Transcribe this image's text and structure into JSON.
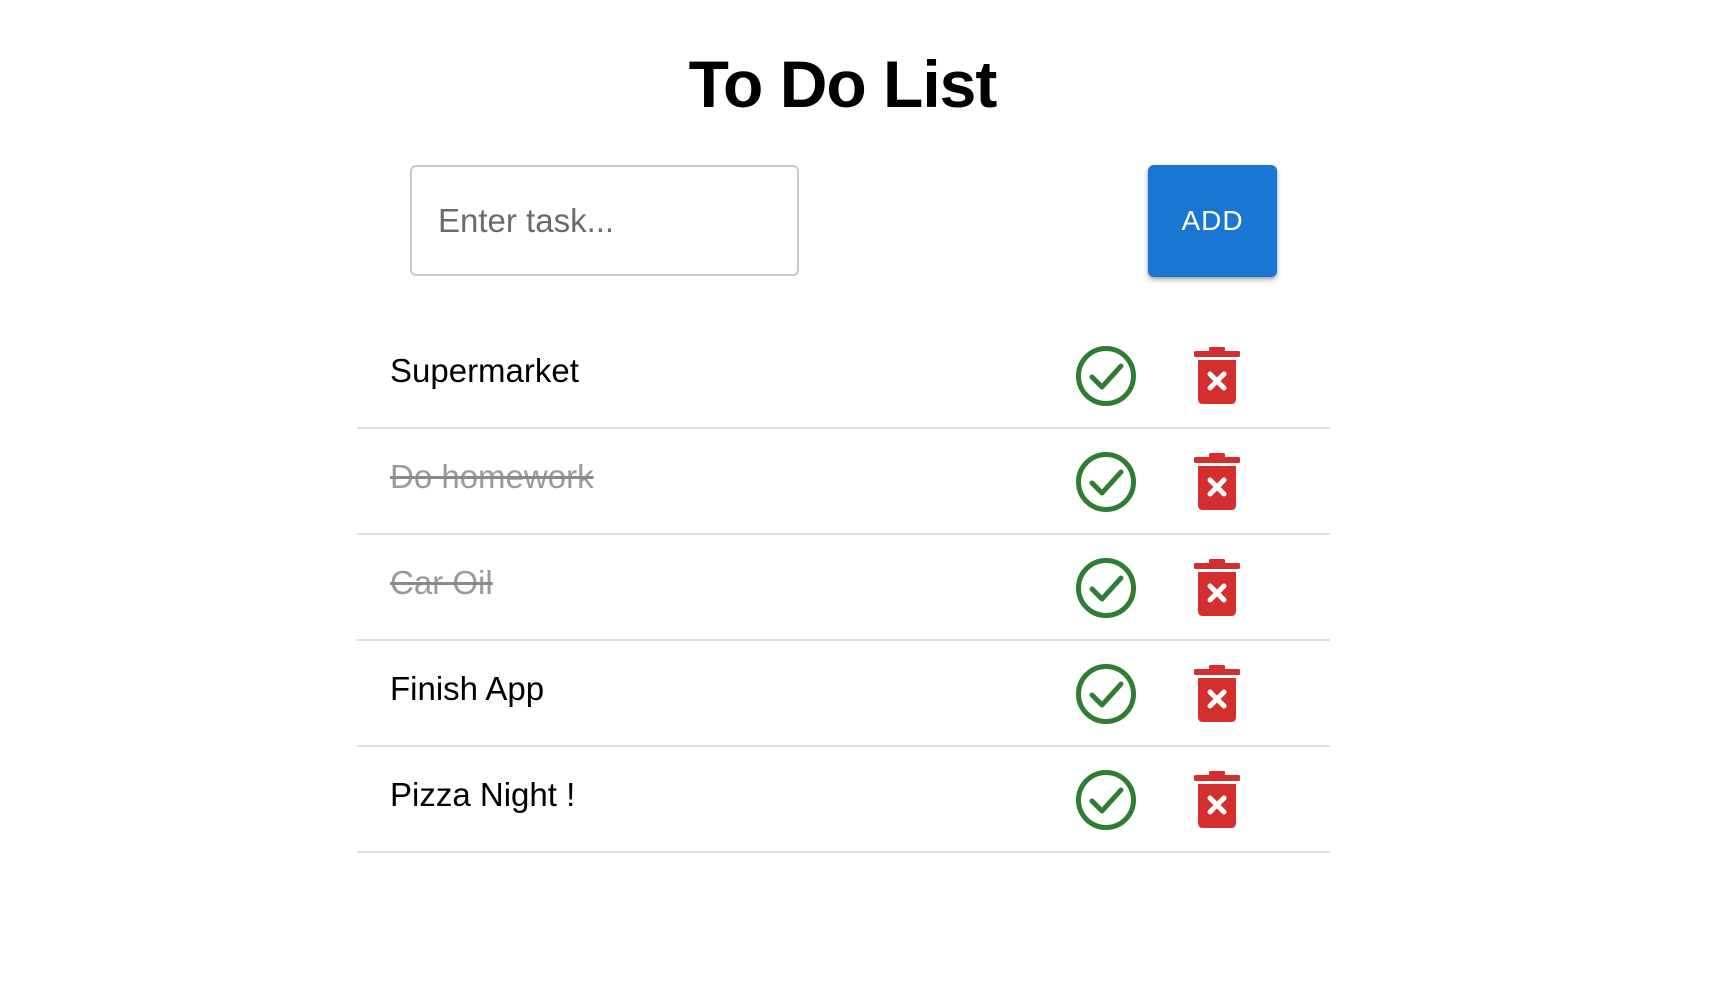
{
  "header": {
    "title": "To Do List"
  },
  "form": {
    "input_value": "",
    "input_placeholder": "Enter task...",
    "add_label": "ADD"
  },
  "tasks": [
    {
      "text": "Supermarket",
      "completed": false
    },
    {
      "text": "Do homework",
      "completed": true
    },
    {
      "text": "Car Oil",
      "completed": true
    },
    {
      "text": "Finish App",
      "completed": false
    },
    {
      "text": "Pizza Night !",
      "completed": false
    }
  ],
  "icons": {
    "complete": "check-circle-icon",
    "delete": "trash-x-icon"
  },
  "colors": {
    "accent": "#1976d2",
    "complete": "#2e7d32",
    "delete": "#d32f2f",
    "completed_text": "#9a9a9a"
  }
}
